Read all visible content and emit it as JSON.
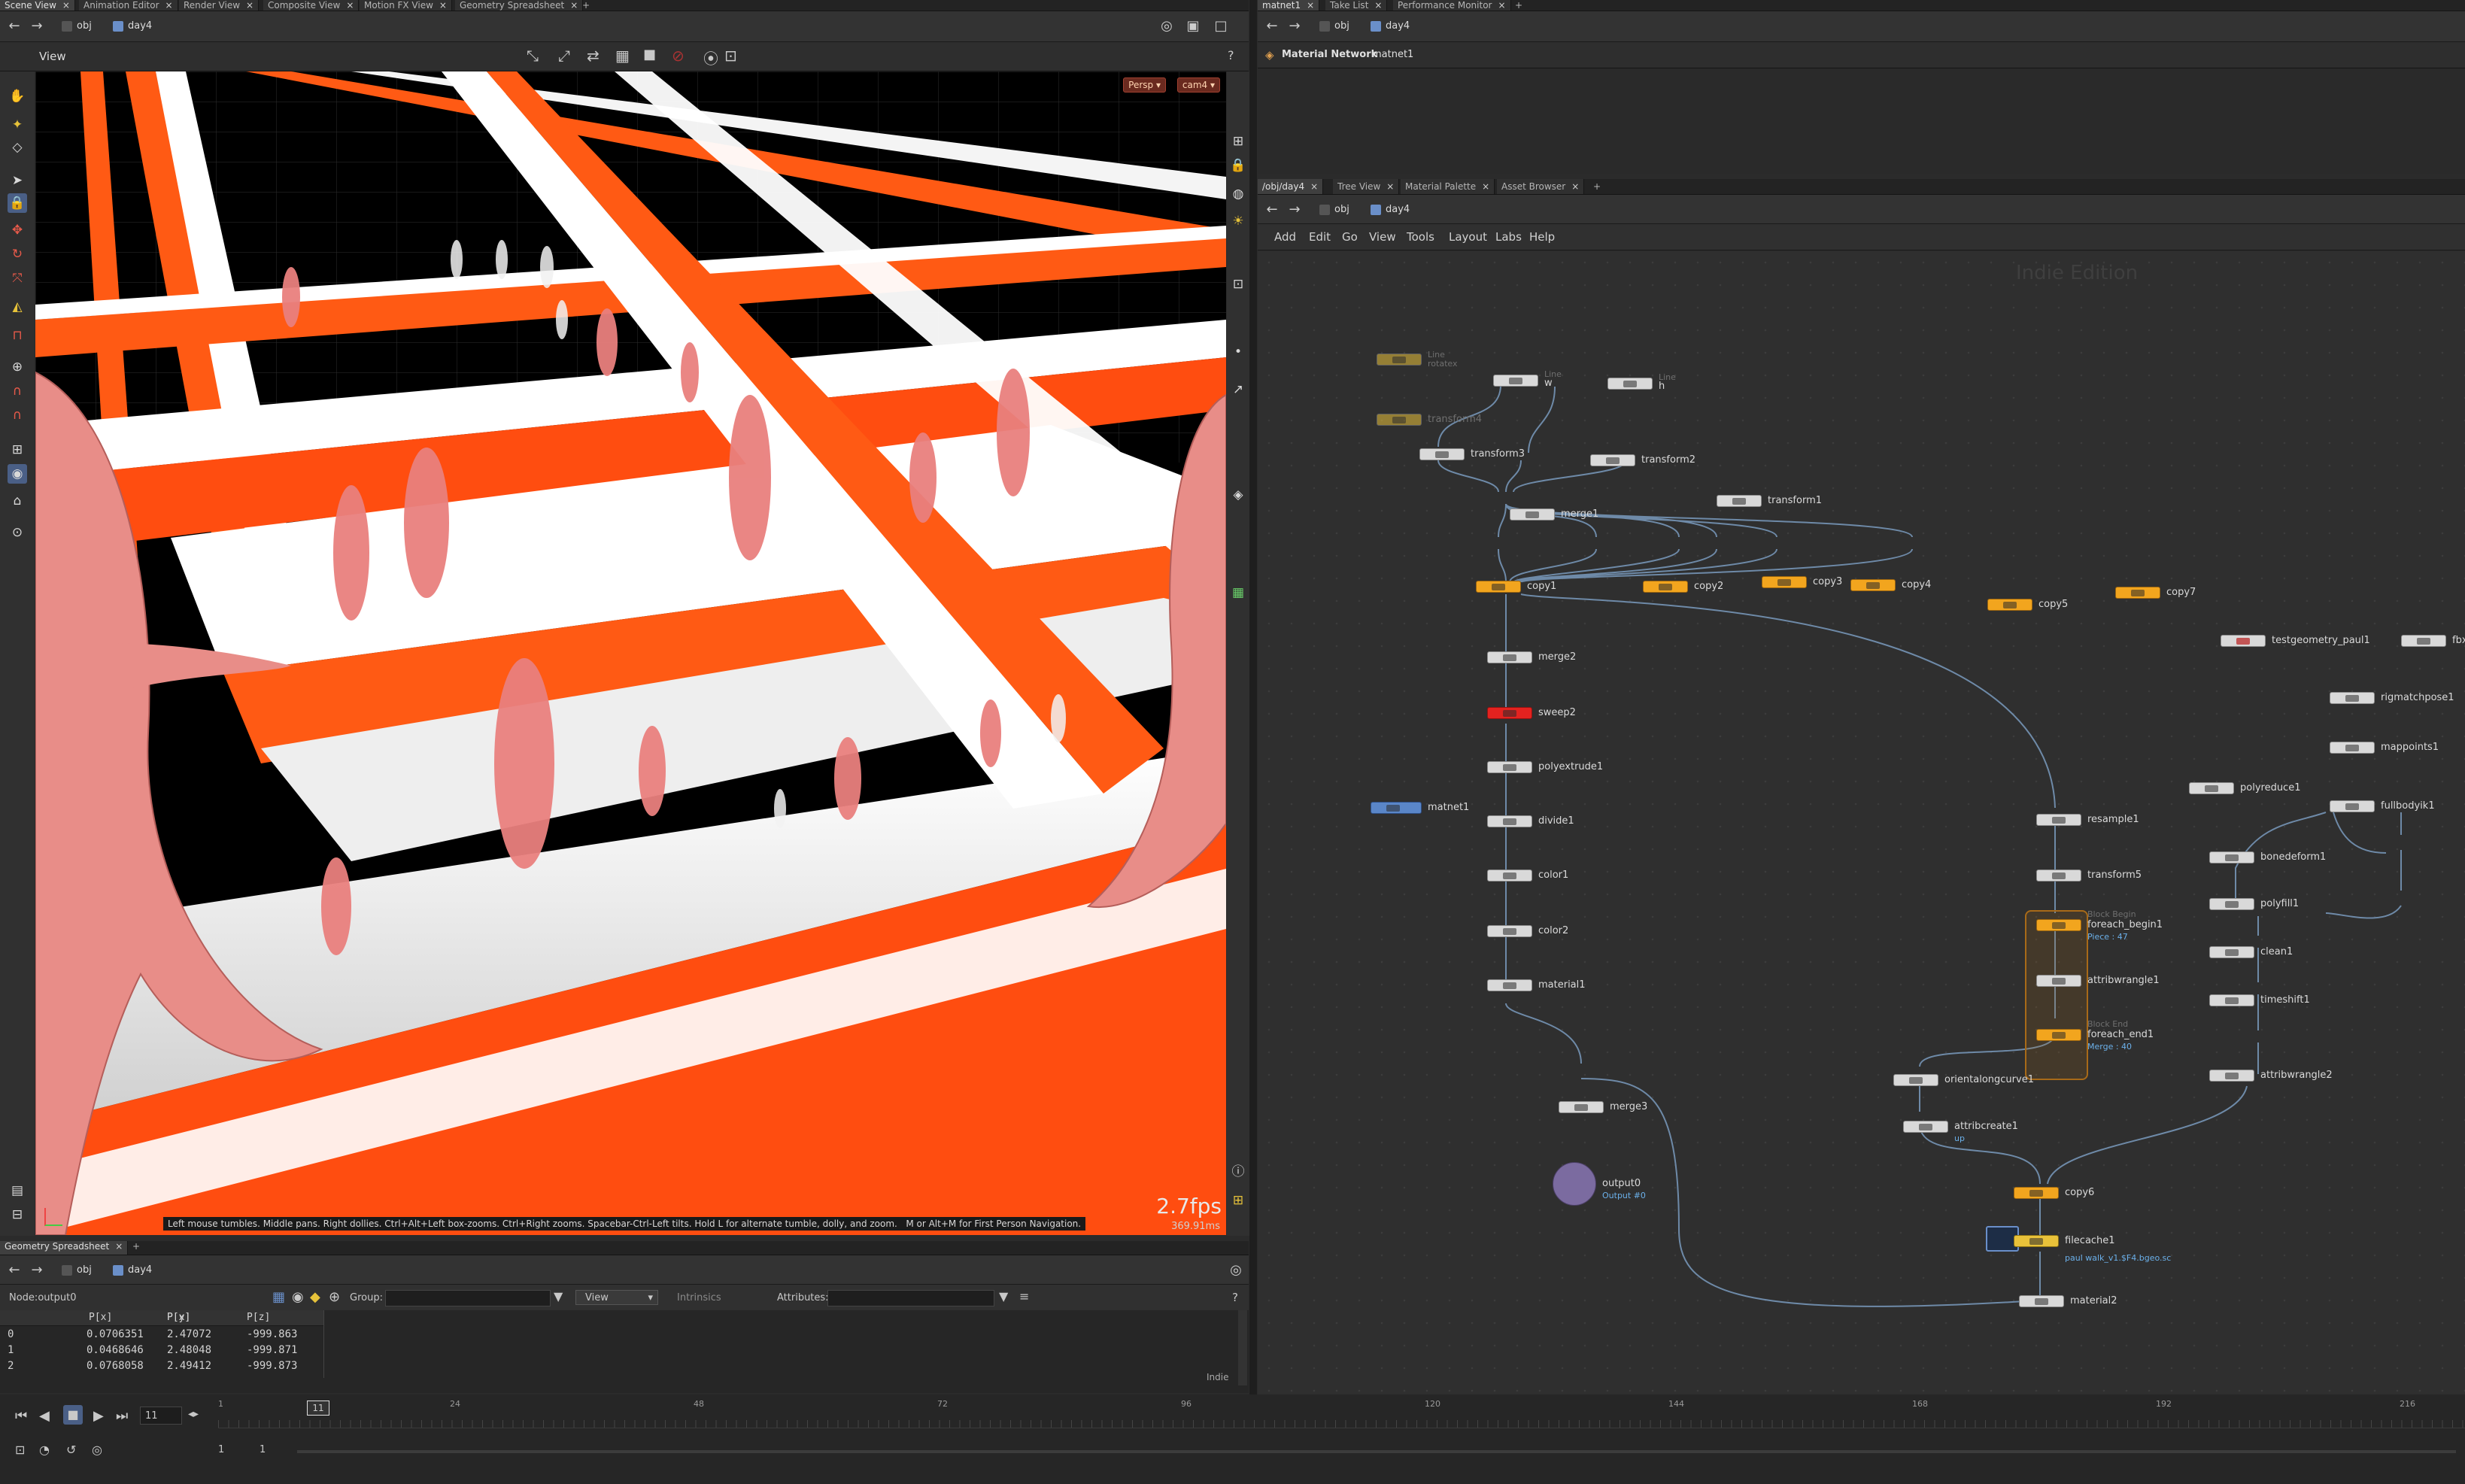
{
  "left_tabs": [
    "Scene View",
    "Animation Editor",
    "Render View",
    "Composite View",
    "Motion FX View",
    "Geometry Spreadsheet",
    "+"
  ],
  "right_top_tabs": [
    "matnet1",
    "Take List",
    "Performance Monitor",
    "+"
  ],
  "right_mid_tabs": [
    "/obj/day4",
    "Tree View",
    "Material Palette",
    "Asset Browser",
    "+"
  ],
  "sheet_tabs": [
    "Geometry Spreadsheet",
    "+"
  ],
  "left_path": {
    "obj": "obj",
    "node": "day4"
  },
  "right_path_top": {
    "obj": "obj",
    "node": "day4"
  },
  "right_path_mid": {
    "obj": "obj",
    "node": "day4"
  },
  "sheet_path": {
    "obj": "obj",
    "node": "day4"
  },
  "viewer": {
    "title": "View",
    "persp": "Persp",
    "camera": "cam4",
    "fps": "2.7fps",
    "ms": "369.91ms",
    "status": "Left mouse tumbles. Middle pans. Right dollies. Ctrl+Alt+Left box-zooms. Ctrl+Right zooms. Spacebar-Ctrl-Left tilts. Hold L for alternate tumble, dolly, and zoom.",
    "status2": "M or Alt+M for First Person Navigation."
  },
  "material_network": {
    "label": "Material Network",
    "name": "matnet1"
  },
  "network_menu": [
    "Add",
    "Edit",
    "Go",
    "View",
    "Tools",
    "Layout",
    "Labs",
    "Help"
  ],
  "watermark": "Indie Edition",
  "nodes": [
    {
      "name": "Line",
      "sub": "rotatex",
      "kind": "bypass",
      "dim": true
    },
    {
      "name": "transform4",
      "kind": "bypass",
      "dim": true
    },
    {
      "name": "w",
      "pre": "Line",
      "kind": "grey"
    },
    {
      "name": "h",
      "pre": "Line",
      "kind": "grey"
    },
    {
      "name": "transform3",
      "kind": "grey"
    },
    {
      "name": "transform2",
      "kind": "grey"
    },
    {
      "name": "transform1",
      "kind": "grey"
    },
    {
      "name": "merge1",
      "kind": "grey"
    },
    {
      "name": "copy1",
      "kind": "orange"
    },
    {
      "name": "copy2",
      "kind": "orange"
    },
    {
      "name": "copy3",
      "kind": "orange"
    },
    {
      "name": "copy4",
      "kind": "orange"
    },
    {
      "name": "copy5",
      "kind": "orange"
    },
    {
      "name": "copy7",
      "kind": "orange"
    },
    {
      "name": "merge2",
      "kind": "grey"
    },
    {
      "name": "sweep2",
      "kind": "red"
    },
    {
      "name": "polyextrude1",
      "kind": "grey"
    },
    {
      "name": "matnet1",
      "kind": "blue"
    },
    {
      "name": "divide1",
      "kind": "grey"
    },
    {
      "name": "color1",
      "kind": "grey"
    },
    {
      "name": "color2",
      "kind": "grey"
    },
    {
      "name": "material1",
      "kind": "grey"
    },
    {
      "name": "merge3",
      "kind": "grey"
    },
    {
      "name": "output0",
      "sub": "Output #0",
      "kind": "purple"
    },
    {
      "name": "resample1",
      "kind": "grey"
    },
    {
      "name": "transform5",
      "kind": "grey"
    },
    {
      "name": "foreach_begin1",
      "pre": "Block Begin",
      "sub": "Piece : 47",
      "kind": "orange"
    },
    {
      "name": "attribwrangle1",
      "kind": "grey"
    },
    {
      "name": "foreach_end1",
      "pre": "Block End",
      "sub": "Merge : 40",
      "kind": "orange"
    },
    {
      "name": "orientalongcurve1",
      "kind": "grey"
    },
    {
      "name": "attribcreate1",
      "sub": "up",
      "kind": "grey"
    },
    {
      "name": "copy6",
      "kind": "orange"
    },
    {
      "name": "filecache1",
      "sub": "paul walk_v1.$F4.bgeo.sc",
      "kind": "yellow"
    },
    {
      "name": "material2",
      "kind": "grey"
    },
    {
      "name": "testgeometry_paul1",
      "kind": "grey"
    },
    {
      "name": "fbx",
      "kind": "grey"
    },
    {
      "name": "rigmatchpose1",
      "kind": "grey"
    },
    {
      "name": "mappoints1",
      "kind": "grey"
    },
    {
      "name": "polyreduce1",
      "kind": "grey"
    },
    {
      "name": "fullbodyik1",
      "kind": "grey"
    },
    {
      "name": "bonedeform1",
      "kind": "grey"
    },
    {
      "name": "polyfill1",
      "kind": "grey"
    },
    {
      "name": "clean1",
      "kind": "grey"
    },
    {
      "name": "timeshift1",
      "kind": "grey"
    },
    {
      "name": "attribwrangle2",
      "kind": "grey"
    }
  ],
  "sheet": {
    "node_label": "Node:",
    "node_value": "output0",
    "group_label": "Group:",
    "view_label": "View",
    "intrinsics_label": "Intrinsics",
    "attributes_label": "Attributes:",
    "columns": [
      "",
      "P[x]",
      "P[y]",
      "P[z]"
    ],
    "rows": [
      [
        "0",
        "0.0706351",
        "2.47072",
        "-999.863"
      ],
      [
        "1",
        "0.0468646",
        "2.48048",
        "-999.871"
      ],
      [
        "2",
        "0.0768058",
        "2.49412",
        "-999.873"
      ]
    ],
    "footer": "Indie"
  },
  "timeline": {
    "current_frame": "11",
    "frame_field": "11",
    "start": "1",
    "end": "1",
    "ticks": [
      "1",
      "24",
      "48",
      "72",
      "96",
      "120",
      "144",
      "168",
      "192",
      "216"
    ]
  },
  "colors": {
    "accent_orange": "#f2a51e",
    "sweep_red": "#e4221f",
    "link_blue": "#6bb0ea",
    "bg": "#2b2b2b"
  }
}
